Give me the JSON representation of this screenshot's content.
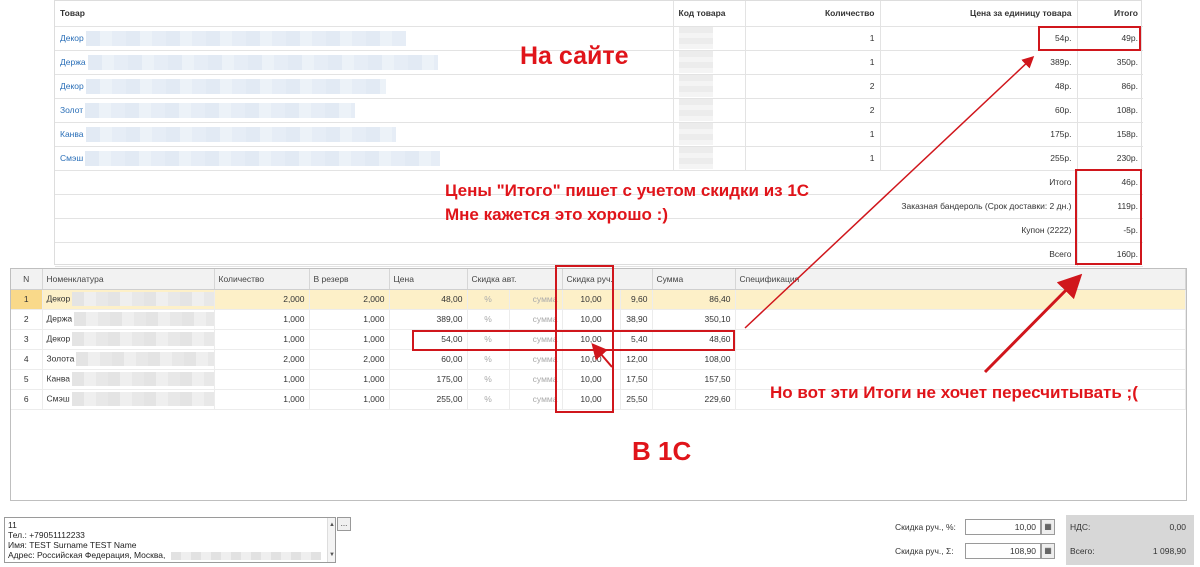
{
  "site_table": {
    "headers": {
      "product": "Товар",
      "code": "Код товара",
      "qty": "Количество",
      "unit_price": "Цена за единицу товара",
      "total": "Итого"
    },
    "rows": [
      {
        "name": "Декор",
        "qty": "1",
        "price": "54р.",
        "total": "49р."
      },
      {
        "name": "Держа",
        "qty": "1",
        "price": "389р.",
        "total": "350р."
      },
      {
        "name": "Декор",
        "qty": "2",
        "price": "48р.",
        "total": "86р."
      },
      {
        "name": "Золот",
        "qty": "2",
        "price": "60р.",
        "total": "108р."
      },
      {
        "name": "Канва",
        "qty": "1",
        "price": "175р.",
        "total": "158р."
      },
      {
        "name": "Смэш",
        "qty": "1",
        "price": "255р.",
        "total": "230р."
      }
    ],
    "summary": [
      {
        "label": "Итого",
        "value": "46р."
      },
      {
        "label": "Заказная бандероль (Срок доставки: 2 дн.)",
        "value": "119р."
      },
      {
        "label": "Купон (2222)",
        "value": "-5р."
      },
      {
        "label": "Всего",
        "value": "160р."
      }
    ]
  },
  "onec_table": {
    "headers": {
      "n": "N",
      "nomenclature": "Номенклатура",
      "qty": "Количество",
      "reserve": "В резерв",
      "price": "Цена",
      "auto_discount": "Скидка авт.",
      "manual_discount": "Скидка руч.",
      "sum": "Сумма",
      "spec": "Спецификация"
    },
    "rows": [
      {
        "n": "1",
        "name": "Декор",
        "qty": "2,000",
        "reserve": "2,000",
        "price": "48,00",
        "pct": "%",
        "sum_lbl": "сумма",
        "manual": "10,00",
        "disc": "9,60",
        "sum": "86,40"
      },
      {
        "n": "2",
        "name": "Держа",
        "qty": "1,000",
        "reserve": "1,000",
        "price": "389,00",
        "pct": "%",
        "sum_lbl": "сумма",
        "manual": "10,00",
        "disc": "38,90",
        "sum": "350,10"
      },
      {
        "n": "3",
        "name": "Декор",
        "qty": "1,000",
        "reserve": "1,000",
        "price": "54,00",
        "pct": "%",
        "sum_lbl": "сумма",
        "manual": "10,00",
        "disc": "5,40",
        "sum": "48,60"
      },
      {
        "n": "4",
        "name": "Золота",
        "qty": "2,000",
        "reserve": "2,000",
        "price": "60,00",
        "pct": "%",
        "sum_lbl": "сумма",
        "manual": "10,00",
        "disc": "12,00",
        "sum": "108,00"
      },
      {
        "n": "5",
        "name": "Канва",
        "qty": "1,000",
        "reserve": "1,000",
        "price": "175,00",
        "pct": "%",
        "sum_lbl": "сумма",
        "manual": "10,00",
        "disc": "17,50",
        "sum": "157,50"
      },
      {
        "n": "6",
        "name": "Смэш",
        "qty": "1,000",
        "reserve": "1,000",
        "price": "255,00",
        "pct": "%",
        "sum_lbl": "сумма",
        "manual": "10,00",
        "disc": "25,50",
        "sum": "229,60"
      }
    ]
  },
  "memo": {
    "line1": "11",
    "line2": "Тел.: +79051112233",
    "line3": "Имя: TEST Surname TEST Name",
    "line4": "Адрес: Российская Федерация, Москва,"
  },
  "memo_button": "...",
  "discounts": {
    "pct_label": "Скидка руч., %:",
    "pct_value": "10,00",
    "sum_label": "Скидка руч., Σ:",
    "sum_value": "108,90"
  },
  "totals": {
    "vat_label": "НДС:",
    "vat_value": "0,00",
    "total_label": "Всего:",
    "total_value": "1 098,90"
  },
  "annotations": {
    "site": "На сайте",
    "note_line1": "Цены \"Итого\" пишет с учетом скидки из 1С",
    "note_line2": "Мне кажется это хорошо :)",
    "onec": "В 1С",
    "complaint": "Но вот эти Итоги не хочет пересчитывать ;("
  },
  "colors": {
    "annotation_red": "#d0161c",
    "link_blue": "#2a6fb8",
    "selected_row": "#fdf0c8",
    "totals_panel": "#d7d7d7"
  }
}
